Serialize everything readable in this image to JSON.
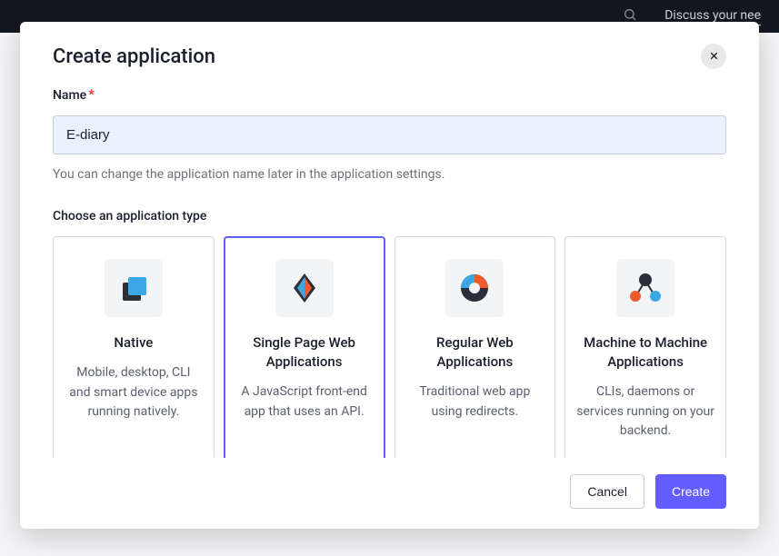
{
  "topbar": {
    "discuss_label": "Discuss your nee"
  },
  "modal": {
    "title": "Create application",
    "name_label": "Name",
    "name_required": "*",
    "name_value": "E-diary",
    "name_helper": "You can change the application name later in the application settings.",
    "type_section_label": "Choose an application type",
    "cancel_label": "Cancel",
    "create_label": "Create"
  },
  "types": [
    {
      "title": "Native",
      "desc": "Mobile, desktop, CLI and smart device apps running natively."
    },
    {
      "title": "Single Page Web Applications",
      "desc": "A JavaScript front-end app that uses an API."
    },
    {
      "title": "Regular Web Applications",
      "desc": "Traditional web app using redirects."
    },
    {
      "title": "Machine to Machine Applications",
      "desc": "CLIs, daemons or services running on your backend."
    }
  ]
}
